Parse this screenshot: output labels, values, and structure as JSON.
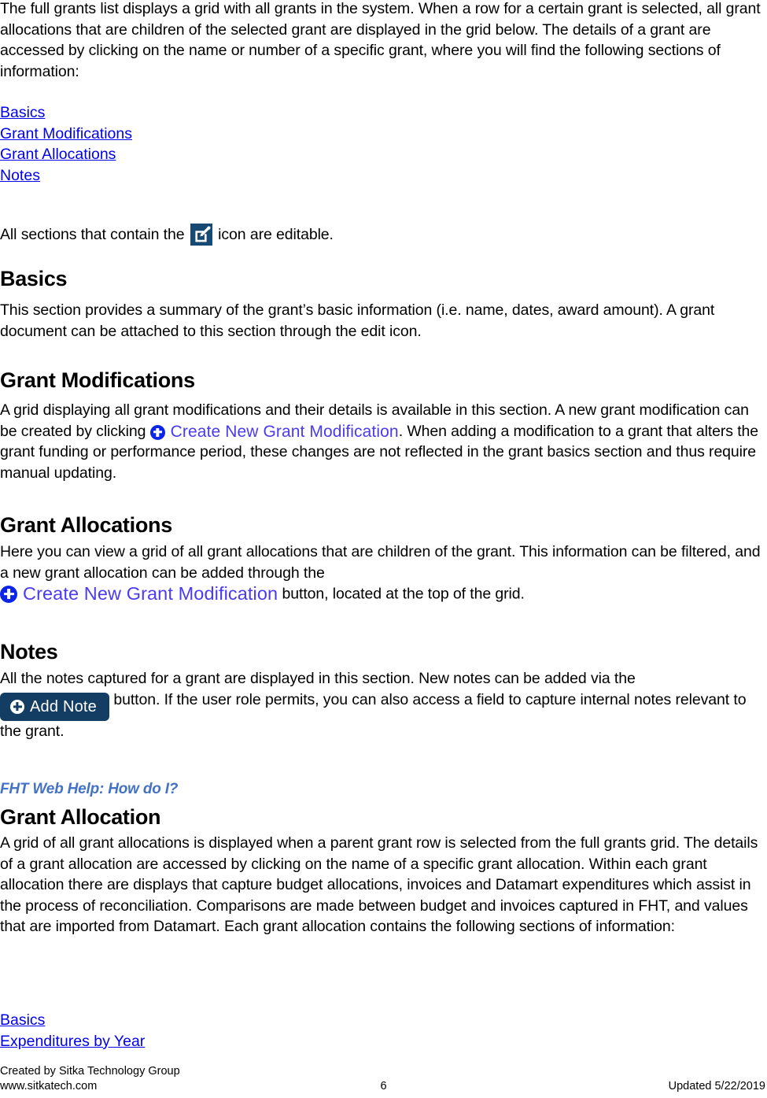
{
  "document": {
    "intro_paragraph": "The full grants list displays a grid with all grants in the system.  When a row for a certain grant is selected, all grant allocations that are children of the selected grant are displayed in the grid below.  The details of a grant are accessed by clicking on the name or number of a specific grant, where you will find the following sections of information:",
    "toc_links": [
      {
        "label": "Basics"
      },
      {
        "label": "Grant Modifications"
      },
      {
        "label": "Grant Allocations"
      },
      {
        "label": "Notes"
      }
    ],
    "editable_note": {
      "before": "All sections that contain the",
      "icon_name": "edit-icon",
      "after": "icon are editable."
    },
    "sections": [
      {
        "heading": "Basics",
        "paragraph": "This section provides a summary of the grant’s basic information (i.e. name, dates, award amount).  A grant document can be attached to this section through the edit icon."
      },
      {
        "heading": "Grant Modifications",
        "part1": "A grid displaying all grant modifications and their details is available in this section.  A new grant modification can be created by clicking",
        "button_label": "Create New Grant Modification",
        "part2": ".  When adding a modification to a grant that alters the grant funding or performance period, these changes are not reflected in the grant basics section and thus require manual updating."
      },
      {
        "heading": "Grant Allocations",
        "part1": "Here you can view a grid of all grant allocations that are children of the grant.  This information can be filtered, and a new grant allocation can be added through the",
        "button_label": "Create New Grant Modification",
        "part2": "button, located at the top of the grid."
      },
      {
        "heading": "Notes",
        "part1": "All the notes captured for a grant are displayed in this section.  New notes can be added via the",
        "button_label": "Add Note",
        "part2": "button.  If the user role permits, you can also access a field to capture internal notes relevant to the grant."
      }
    ],
    "web_help_label": "FHT Web Help: How do I?",
    "grant_allocation": {
      "heading": "Grant Allocation",
      "paragraph": "A grid of all grant allocations is displayed when a parent grant row is selected from the full grants grid.  The details of a grant allocation are accessed by clicking on the name of a specific grant allocation.  Within each grant allocation there are displays that capture budget allocations, invoices and Datamart expenditures which assist in the process of reconciliation.  Comparisons are made between budget and invoices captured in FHT, and values that are imported from Datamart.  Each grant allocation contains the following sections of information:",
      "toc_links": [
        {
          "label": "Basics"
        },
        {
          "label": "Expenditures by Year"
        }
      ]
    },
    "footer": {
      "created_by": "Created by Sitka Technology Group",
      "website": "www.sitkatech.com",
      "page_number": "6",
      "updated": "Updated 5/22/2019"
    },
    "colors": {
      "link": "#0000EE",
      "accent_heading": "#4472C4",
      "button_navy": "#133D63",
      "icon_navy": "#174A73",
      "create_link": "#4B3BF0",
      "plus_blue": "#0A24E8"
    }
  }
}
